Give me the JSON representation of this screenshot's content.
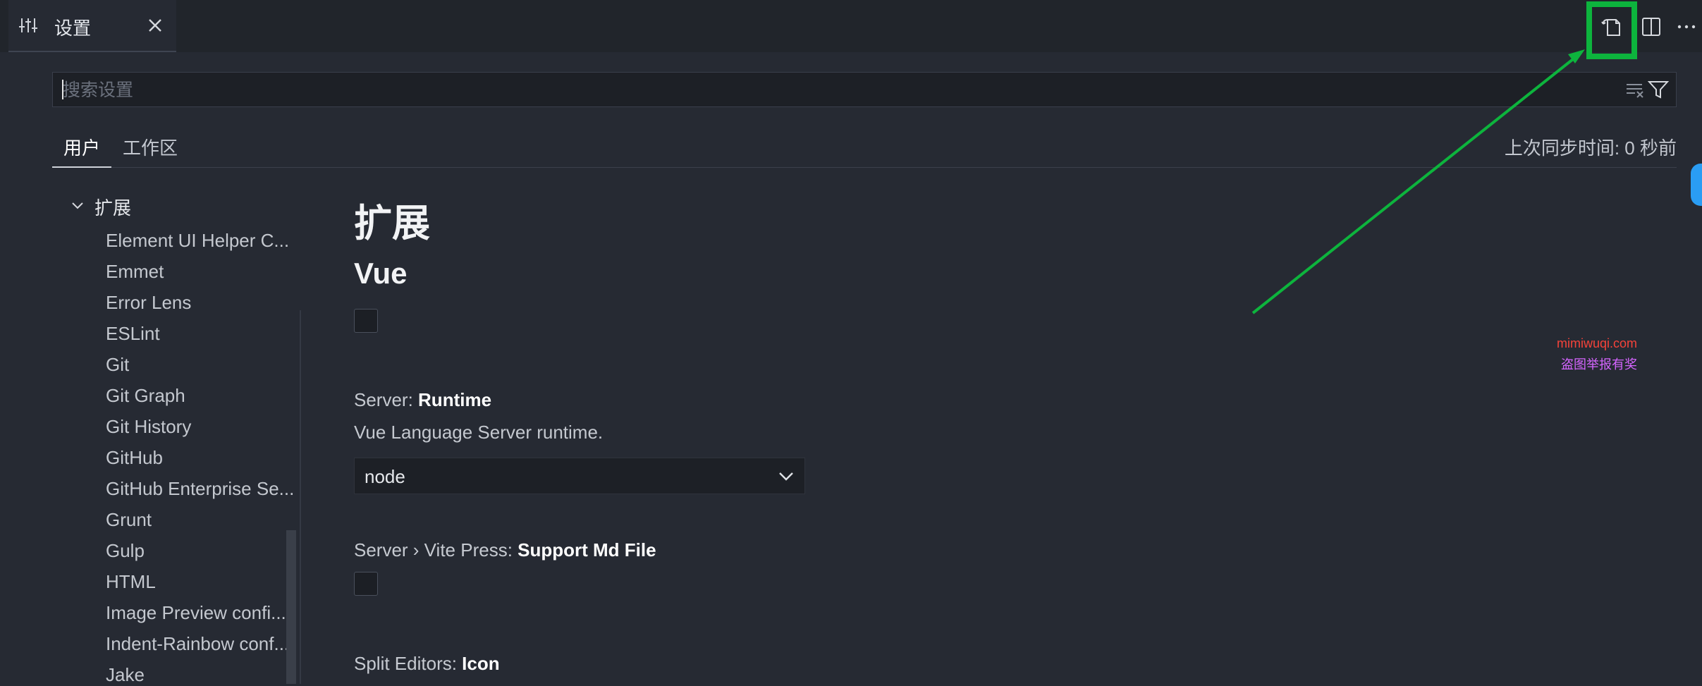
{
  "tab": {
    "title": "设置",
    "icon": "sliders-icon",
    "close_icon": "close-icon"
  },
  "toolbar": {
    "open_json_icon": "open-settings-json-icon",
    "split_icon": "split-editor-icon",
    "more_icon": "more-actions-icon",
    "highlight_color": "#0db43d"
  },
  "search": {
    "placeholder": "搜索设置",
    "value": "",
    "clear_icon": "clear-filter-icon",
    "filter_icon": "filter-icon"
  },
  "scopes": {
    "user": "用户",
    "workspace": "工作区",
    "active": "用户"
  },
  "sync_status": "上次同步时间: 0 秒前",
  "tree": {
    "section_label": "扩展",
    "items": [
      "Element UI Helper C...",
      "Emmet",
      "Error Lens",
      "ESLint",
      "Git",
      "Git Graph",
      "Git History",
      "GitHub",
      "GitHub Enterprise Se...",
      "Grunt",
      "Gulp",
      "HTML",
      "Image Preview confi...",
      "Indent-Rainbow conf...",
      "Jake"
    ]
  },
  "main": {
    "heading": "扩展",
    "subheading": "Vue",
    "settings": [
      {
        "prefix": "Server: ",
        "name": "Runtime",
        "description": "Vue Language Server runtime.",
        "value": "node"
      },
      {
        "prefix": "Server › Vite Press: ",
        "name": "Support Md File"
      },
      {
        "prefix": "Split Editors: ",
        "name": "Icon"
      }
    ]
  },
  "watermark": {
    "line1": "mimiwuqi.com",
    "line2": "盗图举报有奖"
  },
  "colors": {
    "accent_arrow": "#0db43d",
    "background": "#262a33"
  }
}
